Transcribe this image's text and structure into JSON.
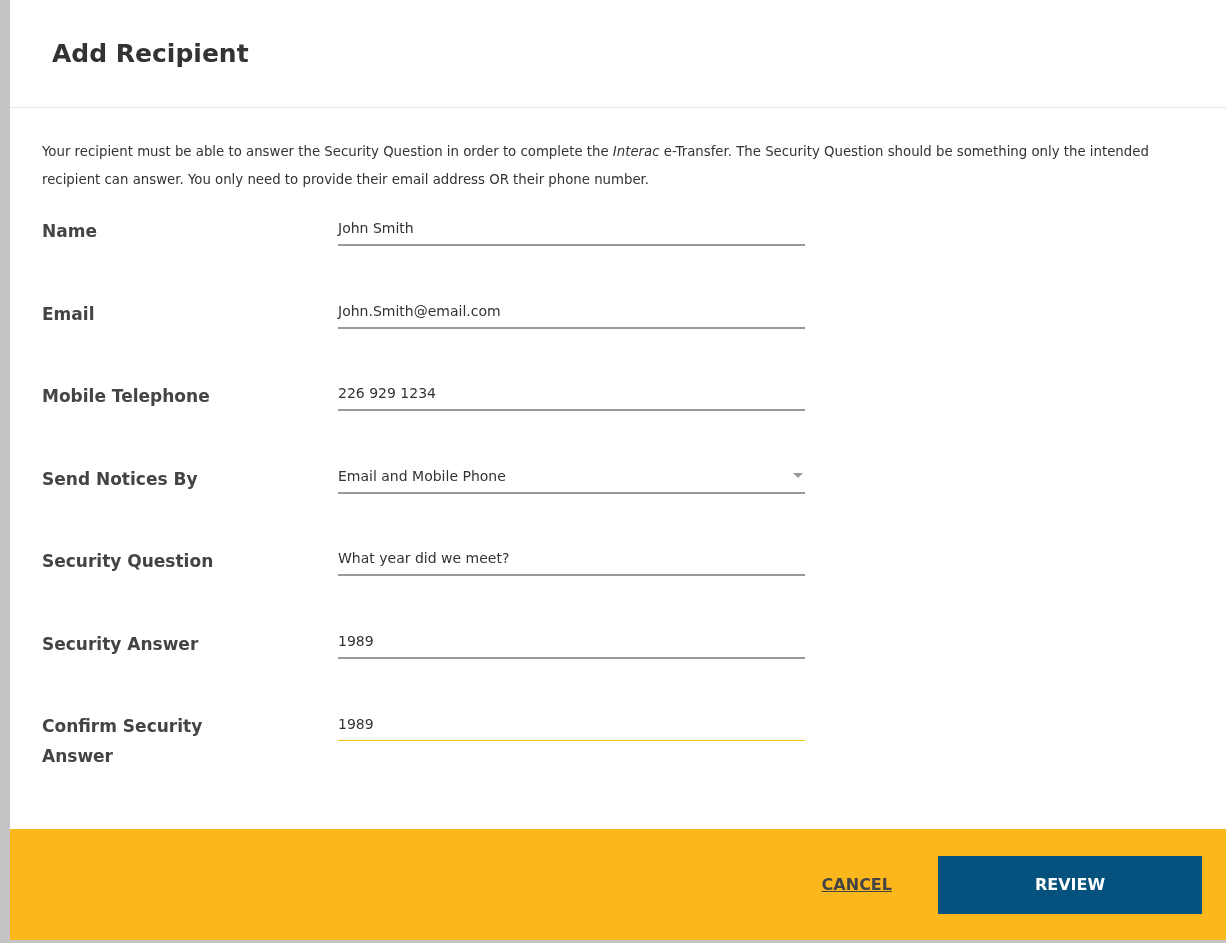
{
  "dialog": {
    "title": "Add Recipient",
    "intro": "Your recipient must be able to answer the Security Question in order to complete the *Interac* e-Transfer. The Security Question should be something only the intended recipient can answer. You only need to provide their email address OR their phone number.",
    "fields": [
      {
        "label": "Name",
        "kind": "text",
        "value": "John Smith",
        "focused": false
      },
      {
        "label": "Email",
        "kind": "text",
        "value": "John.Smith@email.com",
        "focused": false
      },
      {
        "label": "Mobile Telephone",
        "kind": "text",
        "value": "226 929 1234",
        "focused": false
      },
      {
        "label": "Send Notices By",
        "kind": "select",
        "value": "Email and Mobile Phone",
        "focused": false
      },
      {
        "label": "Security Question",
        "kind": "text",
        "value": "What year did we meet?",
        "focused": false
      },
      {
        "label": "Security Answer",
        "kind": "text",
        "value": "1989",
        "focused": false
      },
      {
        "label": "Confirm Security Answer",
        "kind": "text",
        "value": "1989",
        "focused": true
      }
    ],
    "buttons": [
      {
        "label": "CANCEL",
        "kind": "link"
      },
      {
        "label": "REVIEW",
        "kind": "primary"
      }
    ]
  }
}
